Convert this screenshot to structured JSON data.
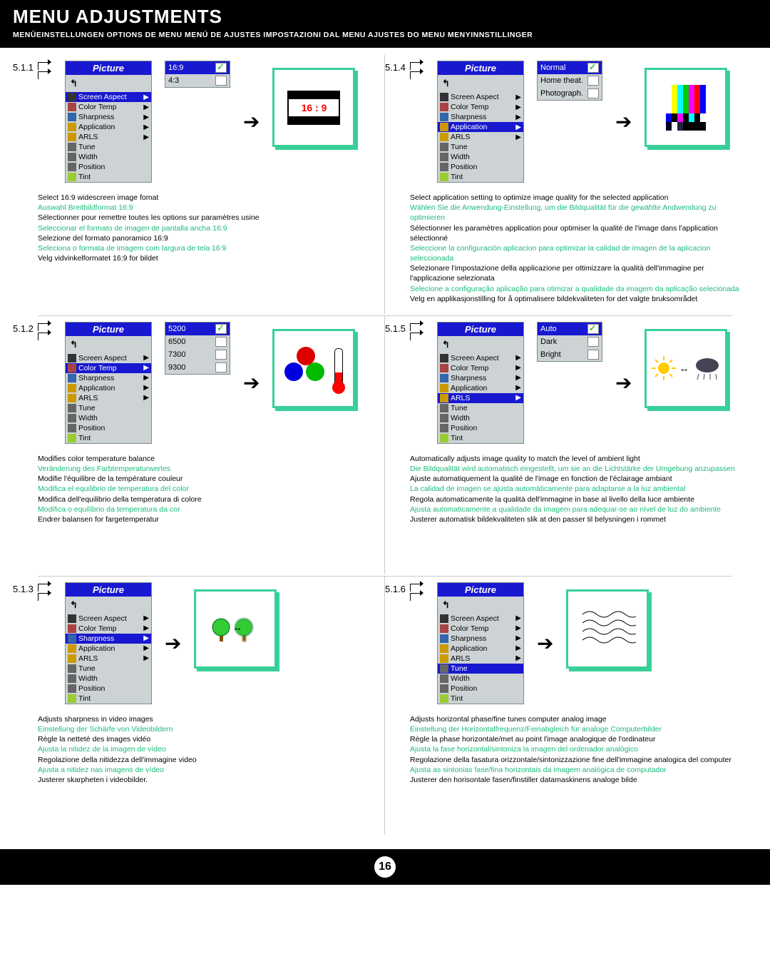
{
  "header": {
    "title": "MENU ADJUSTMENTS",
    "subtitles": [
      "MENÜEINSTELLUNGEN",
      "OPTIONS DE MENU",
      "MENÚ DE AJUSTES",
      "IMPOSTAZIONI DAL MENU",
      "AJUSTES DO MENU",
      "MENYINNSTILLINGER"
    ]
  },
  "menu": {
    "title": "Picture",
    "back": "↰",
    "items": [
      "Screen Aspect",
      "Color Temp",
      "Sharpness",
      "Application",
      "ARLS",
      "Tune",
      "Width",
      "Position",
      "Tint"
    ]
  },
  "sections": [
    {
      "id": "5.1.1",
      "highlight": 0,
      "submenu": [
        "16:9",
        "4:3"
      ],
      "sub_sel": 0,
      "preview_label": "16 : 9",
      "desc": [
        {
          "t": "Select 16:9 widescreen image fomat",
          "c": 0
        },
        {
          "t": "Auswahl Breitbildformat 16:9",
          "c": 1
        },
        {
          "t": "Sélectionner pour remettre toutes les options sur paramètres usine",
          "c": 0
        },
        {
          "t": "Seleccionar el formato de imagen de pantalla ancha 16:9",
          "c": 1
        },
        {
          "t": "Selezione del formato panoramico 16:9",
          "c": 0
        },
        {
          "t": "Seleciona o formata de imagem com largura de tela 16:9",
          "c": 1
        },
        {
          "t": "Velg vidvinkelformatet 16:9 for bildet",
          "c": 0
        }
      ]
    },
    {
      "id": "5.1.4",
      "highlight": 3,
      "submenu": [
        "Normal",
        "Home theat.",
        "Photograph."
      ],
      "sub_sel": 0,
      "desc": [
        {
          "t": "Select application setting to optimize image quality for the selected application",
          "c": 0
        },
        {
          "t": "Wählen Sie die Anwendung-Einstellung, um die Bildqualität für die gewählte Andwendung zu optimieren",
          "c": 1
        },
        {
          "t": "Sélectionner les paramètres application pour optimiser la qualité de l'image dans l'application sélectionné",
          "c": 0
        },
        {
          "t": "Seleccione la configuración aplicacion para optimizar la calidad de imagen de la aplicacion seleccionada",
          "c": 1
        },
        {
          "t": "Selezionare l'impostazione della applicazione per ottimizzare la qualità dell'immagine per l'applicazione selezionata",
          "c": 0
        },
        {
          "t": "Selecione a configuração aplicação para otimizar a qualidade da imagem da aplicação selecionada",
          "c": 1
        },
        {
          "t": "Velg en applikasjonstilling for å optimalisere bildekvaliteten for det valgte bruksområdet",
          "c": 0
        }
      ]
    },
    {
      "id": "5.1.2",
      "highlight": 1,
      "submenu": [
        "5200",
        "6500",
        "7300",
        "9300"
      ],
      "sub_sel": 0,
      "desc": [
        {
          "t": "Modifies color temperature balance",
          "c": 0
        },
        {
          "t": "Veränderung des Farbtemperaturwertes",
          "c": 1
        },
        {
          "t": "Modifie l'équilibre de la température couleur",
          "c": 0
        },
        {
          "t": "Modifica el equilibrio de temperatura del color",
          "c": 1
        },
        {
          "t": "Modifica dell'equilibrio della temperatura di colore",
          "c": 0
        },
        {
          "t": "Modifica o equilíbrio da temperatura da cor",
          "c": 1
        },
        {
          "t": "Endrer balansen for fargetemperatur",
          "c": 0
        }
      ]
    },
    {
      "id": "5.1.5",
      "highlight": 4,
      "submenu": [
        "Auto",
        "Dark",
        "Bright"
      ],
      "sub_sel": 0,
      "desc": [
        {
          "t": "Automatically adjusts image quality to match the level of ambient light",
          "c": 0
        },
        {
          "t": "Die Bildqualität wird automatisch eingestellt, um sie an die Lichtstärke der Umgebung anzupassen",
          "c": 1
        },
        {
          "t": "Ajuste automatiquement la qualité de l'image en fonction de l'éclairage ambiant",
          "c": 0
        },
        {
          "t": "La calidad de imagen se ajusta automáticamente para adaptarse a la luz ambiental",
          "c": 1
        },
        {
          "t": "Regola automaticamente la qualità dell'immagine in base al livello della luce ambiente",
          "c": 0
        },
        {
          "t": "Ajusta automaticamente a qualidade da imagem para adequar-se ao nível de luz do ambiente",
          "c": 1
        },
        {
          "t": "Justerer automatisk bildekvaliteten slik at den passer til belysningen i rommet",
          "c": 0
        }
      ]
    },
    {
      "id": "5.1.3",
      "highlight": 2,
      "submenu": null,
      "desc": [
        {
          "t": "Adjusts sharpness in video images",
          "c": 0
        },
        {
          "t": "Einstellung der Schärfe von Videobildern",
          "c": 1
        },
        {
          "t": "Règle la netteté des images vidéo",
          "c": 0
        },
        {
          "t": "Ajusta la nitidez de la imagen de vídeo",
          "c": 1
        },
        {
          "t": "Regolazione della nitidezza dell'immagine video",
          "c": 0
        },
        {
          "t": "Ajusta a nitidez nas imagens de vídeo",
          "c": 1
        },
        {
          "t": "Justerer skarpheten i videobilder.",
          "c": 0
        }
      ]
    },
    {
      "id": "5.1.6",
      "highlight": 5,
      "submenu": null,
      "desc": [
        {
          "t": "Adjusts horizontal phase/fine tunes computer analog image",
          "c": 0
        },
        {
          "t": "Einstellung der Horizontalfrequenz/Feinabgleich für analoge Computerbilder",
          "c": 1
        },
        {
          "t": "Règle la phase horizontale/met au point l'image analogique de l'ordinateur",
          "c": 0
        },
        {
          "t": "Ajusta la fase horizontal/sintoniza la imagen del ordenador analógico",
          "c": 1
        },
        {
          "t": "Regolazione della fasatura orizzontale/sintonizzazione fine dell'immagine analogica del computer",
          "c": 0
        },
        {
          "t": "Ajusta as sintonias fase/fina horizontais da imagem analógica de computador",
          "c": 1
        },
        {
          "t": "Justerer den horisontale fasen/finstiller datamaskinens analoge bilde",
          "c": 0
        }
      ]
    }
  ],
  "page_number": "16"
}
